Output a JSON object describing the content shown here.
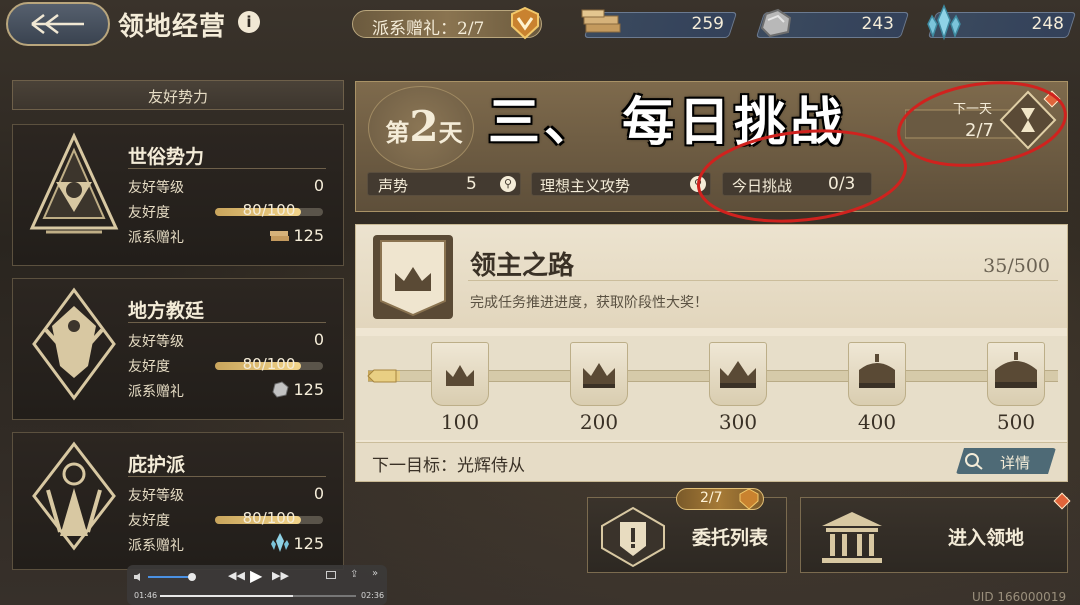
{
  "header": {
    "title": "领地经营",
    "gift_label": "派系赠礼：2/7",
    "resources": [
      {
        "icon": "wood-planks-icon",
        "value": "259"
      },
      {
        "icon": "ore-rock-icon",
        "value": "243"
      },
      {
        "icon": "crystal-icon",
        "value": "248"
      }
    ]
  },
  "factions": {
    "header": "友好势力",
    "items": [
      {
        "name": "世俗势力",
        "level_label": "友好等级",
        "level": "0",
        "friendship_label": "友好度",
        "friendship": "80/100",
        "friendship_fraction": 0.8,
        "gift_label": "派系赠礼",
        "gift_icon": "wood-planks-icon",
        "gift": "125"
      },
      {
        "name": "地方教廷",
        "level_label": "友好等级",
        "level": "0",
        "friendship_label": "友好度",
        "friendship": "80/100",
        "friendship_fraction": 0.8,
        "gift_label": "派系赠礼",
        "gift_icon": "ore-rock-icon",
        "gift": "125"
      },
      {
        "name": "庇护派",
        "level_label": "友好等级",
        "level": "0",
        "friendship_label": "友好度",
        "friendship": "80/100",
        "friendship_fraction": 0.8,
        "gift_label": "派系赠礼",
        "gift_icon": "crystal-icon",
        "gift": "125"
      }
    ]
  },
  "day": {
    "prefix": "第",
    "number": "2",
    "suffix": "天",
    "overlay_title": "三、  每日挑战",
    "stats": [
      {
        "label": "声势",
        "value": "5"
      },
      {
        "label": "理想主义攻势",
        "value": ""
      },
      {
        "label": "今日挑战",
        "value": "0/3"
      }
    ],
    "next_day_label": "下一天",
    "next_day_value": "2/7"
  },
  "lord_road": {
    "title": "领主之路",
    "progress": "35/500",
    "description": "完成任务推进进度，获取阶段性大奖！",
    "progress_fraction": 0.07,
    "milestones": [
      "100",
      "200",
      "300",
      "400",
      "500"
    ],
    "next_target": "下一目标：光辉侍从",
    "details_label": "详情"
  },
  "buttons": {
    "commission_badge": "2/7",
    "commission_label": "委托列表",
    "enter_label": "进入领地"
  },
  "video": {
    "elapsed": "01:46",
    "total": "02:36",
    "played_fraction": 0.68
  },
  "uid": "UID 166000019"
}
